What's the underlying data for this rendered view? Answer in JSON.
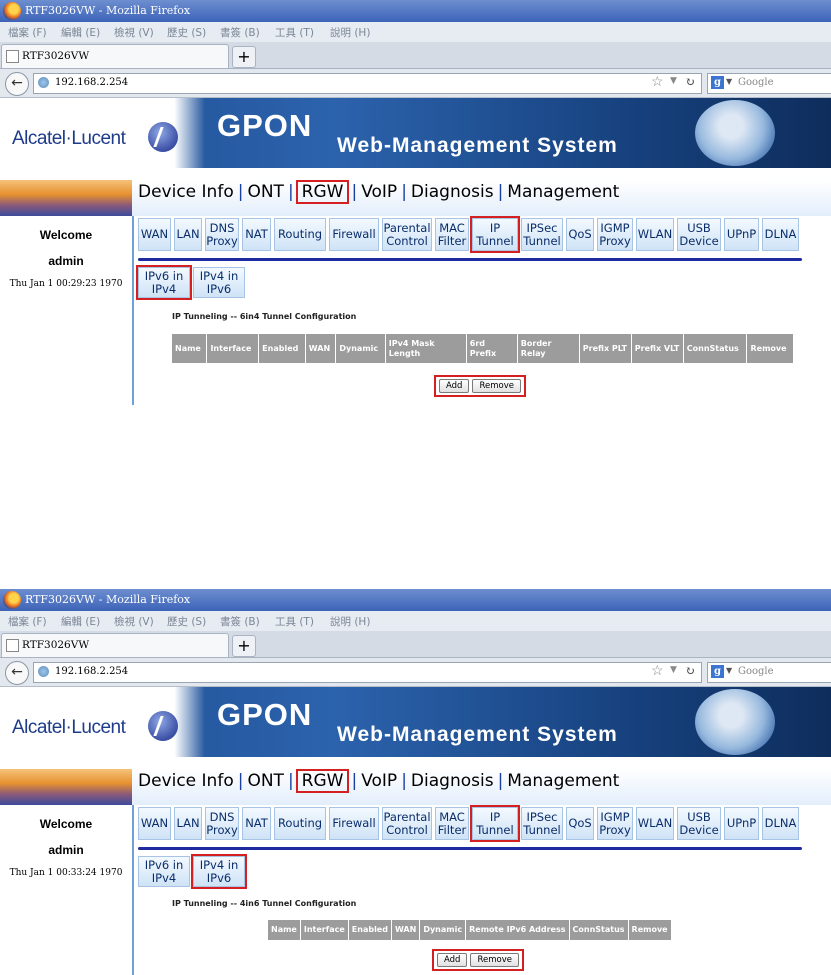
{
  "browser": {
    "window_title": "RTF3026VW - Mozilla Firefox",
    "menu": [
      "檔案 (F)",
      "編輯 (E)",
      "檢視 (V)",
      "歷史 (S)",
      "書簽 (B)",
      "工具 (T)",
      "說明 (H)"
    ],
    "tab_title": "RTF3026VW",
    "new_tab": "+",
    "address": "192.168.2.254",
    "search_placeholder": "Google"
  },
  "header": {
    "brand": "Alcatel·Lucent",
    "gpon": "GPON",
    "subtitle": "Web-Management System"
  },
  "sidebar": {
    "welcome": "Welcome",
    "user": "admin"
  },
  "topnav": [
    "Device Info",
    "ONT",
    "RGW",
    "VoIP",
    "Diagnosis",
    "Management"
  ],
  "subtabs": [
    {
      "label": "WAN"
    },
    {
      "label": "LAN"
    },
    {
      "label": "DNS Proxy"
    },
    {
      "label": "NAT"
    },
    {
      "label": "Routing"
    },
    {
      "label": "Firewall"
    },
    {
      "label": "Parental Control"
    },
    {
      "label": "MAC Filter"
    },
    {
      "label": "IP Tunnel"
    },
    {
      "label": "IPSec Tunnel"
    },
    {
      "label": "QoS"
    },
    {
      "label": "IGMP Proxy"
    },
    {
      "label": "WLAN"
    },
    {
      "label": "USB Device"
    },
    {
      "label": "UPnP"
    },
    {
      "label": "DLNA"
    }
  ],
  "tunnel_tabs": [
    "IPv6 in IPv4",
    "IPv4 in IPv6"
  ],
  "screens": [
    {
      "clock": "Thu Jan 1 00:29:23 1970",
      "config_title": "IP Tunneling -- 6in4 Tunnel Configuration",
      "columns": [
        "Name",
        "Interface",
        "Enabled",
        "WAN",
        "Dynamic",
        "IPv4 Mask Length",
        "6rd Prefix",
        "Border Relay",
        "Prefix PLT",
        "Prefix VLT",
        "ConnStatus",
        "Remove"
      ],
      "buttons": [
        "Add",
        "Remove"
      ]
    },
    {
      "clock": "Thu Jan 1 00:33:24 1970",
      "config_title": "IP Tunneling -- 4in6 Tunnel Configuration",
      "columns": [
        "Name",
        "Interface",
        "Enabled",
        "WAN",
        "Dynamic",
        "Remote IPv6 Address",
        "ConnStatus",
        "Remove"
      ],
      "buttons": [
        "Add",
        "Remove"
      ]
    }
  ],
  "colors": {
    "highlight": "#d42020",
    "tab_text": "#0a2d6a",
    "divider": "#1e2aa0",
    "table_header": "#9c9c9c"
  }
}
